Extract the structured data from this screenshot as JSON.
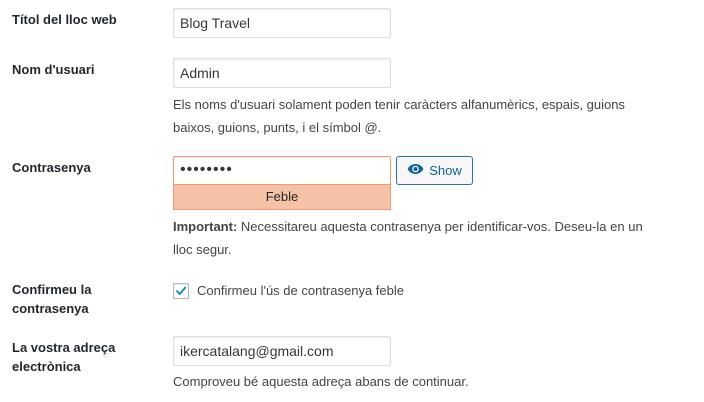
{
  "site_title": {
    "label": "Títol del lloc web",
    "value": "Blog Travel"
  },
  "username": {
    "label": "Nom d'usuari",
    "value": "Admin",
    "hint_line1": "Els noms d'usuari solament poden tenir caràcters alfanumèrics, espais, guions",
    "hint_line2": "baixos, guions, punts, i el símbol @."
  },
  "password": {
    "label": "Contrasenya",
    "value": "••••••••",
    "strength": "Feble",
    "show_button": "Show",
    "important_prefix": "Important:",
    "important_line1": " Necessitareu aquesta contrasenya per identificar-vos. Deseu-la en un",
    "important_line2": "lloc segur."
  },
  "confirm": {
    "label_line1": "Confirmeu la",
    "label_line2": "contrasenya",
    "checkbox_label": "Confirmeu l'ús de contrasenya feble",
    "checked": true
  },
  "email": {
    "label_line1": "La vostra adreça",
    "label_line2": "electrònica",
    "value": "ikercatalang@gmail.com",
    "hint": "Comproveu bé aquesta adreça abans de continuar."
  },
  "colors": {
    "strength_bg": "#f6c2a6",
    "strength_border": "#f09a73",
    "button_text": "#0e6496",
    "button_border": "#2e7199"
  },
  "icons": [
    "eye-icon",
    "checkmark-icon"
  ]
}
